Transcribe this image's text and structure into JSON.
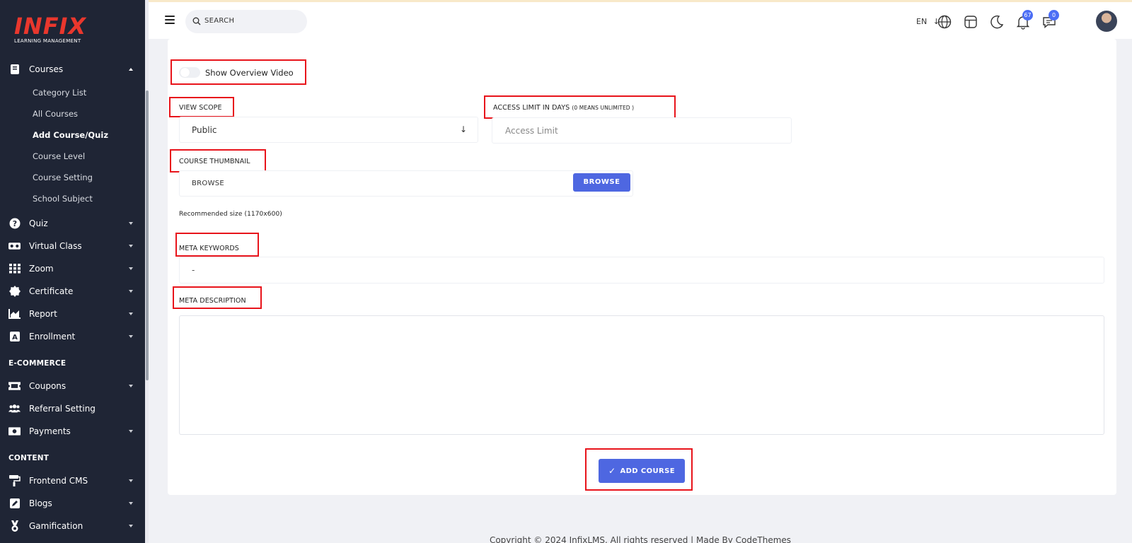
{
  "brand": {
    "logo_text": "INFIX",
    "logo_subtitle": "LEARNING MANAGEMENT",
    "accent_color": "#e9372d"
  },
  "sidebar": {
    "items": [
      {
        "label": "Courses",
        "icon": "book-icon",
        "expanded": true
      },
      {
        "label": "Quiz",
        "icon": "question-circle-icon"
      },
      {
        "label": "Virtual Class",
        "icon": "vr-headset-icon"
      },
      {
        "label": "Zoom",
        "icon": "grid-icon"
      },
      {
        "label": "Certificate",
        "icon": "certificate-seal-icon"
      },
      {
        "label": "Report",
        "icon": "area-chart-icon"
      },
      {
        "label": "Enrollment",
        "icon": "letter-a-icon"
      }
    ],
    "courses_sub": [
      "Category List",
      "All Courses",
      "Add Course/Quiz",
      "Course Level",
      "Course Setting",
      "School Subject"
    ],
    "active_sub": "Add Course/Quiz",
    "ecommerce_heading": "E-COMMERCE",
    "ecommerce_items": [
      {
        "label": "Coupons",
        "icon": "ticket-icon"
      },
      {
        "label": "Referral Setting",
        "icon": "users-icon"
      },
      {
        "label": "Payments",
        "icon": "money-icon"
      }
    ],
    "content_heading": "CONTENT",
    "content_items": [
      {
        "label": "Frontend CMS",
        "icon": "paint-roller-icon"
      },
      {
        "label": "Blogs",
        "icon": "edit-icon"
      },
      {
        "label": "Gamification",
        "icon": "medal-icon"
      }
    ]
  },
  "topbar": {
    "search_label": "SEARCH",
    "language": "EN",
    "notifications_count": "67",
    "messages_count": "0"
  },
  "form": {
    "overview_toggle_label": "Show Overview Video",
    "overview_toggle_on": false,
    "view_scope_label": "VIEW SCOPE",
    "view_scope_value": "Public",
    "access_limit_label": "ACCESS LIMIT IN DAYS",
    "access_limit_hint": "(0 MEANS UNLIMITED )",
    "access_limit_placeholder": "Access Limit",
    "thumbnail_label": "COURSE THUMBNAIL",
    "thumbnail_value": "BROWSE",
    "browse_button": "BROWSE",
    "recommended_size": "Recommended size (1170x600)",
    "meta_keywords_label": "META KEYWORDS",
    "meta_keywords_value": "-",
    "meta_description_label": "META DESCRIPTION",
    "meta_description_value": "",
    "submit_button": "ADD COURSE",
    "submit_icon": "check-icon",
    "button_color": "#4e67e1",
    "highlight_color": "#e8141b"
  },
  "footer": {
    "text": "Copyright © 2024 InfixLMS. All rights reserved | Made By CodeThemes"
  }
}
